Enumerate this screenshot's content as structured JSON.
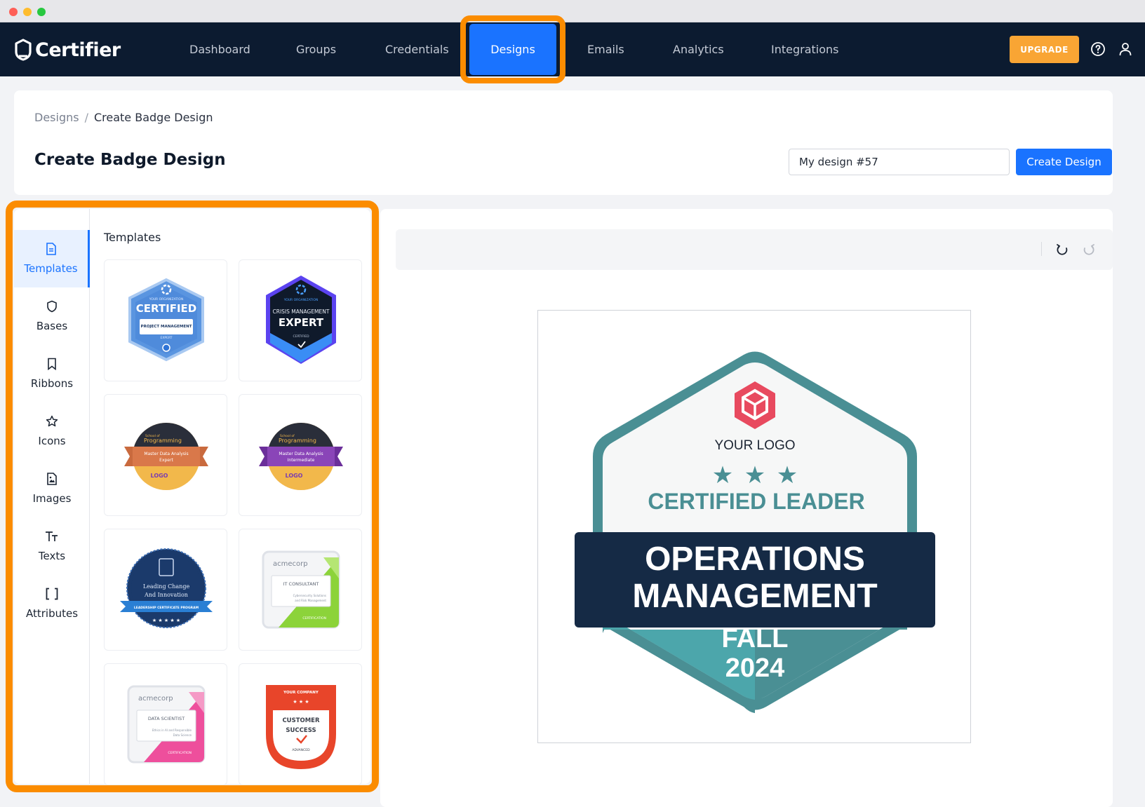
{
  "window": {
    "controls": [
      "close",
      "minimize",
      "maximize"
    ]
  },
  "nav": {
    "brand": "Certifier",
    "items": [
      "Dashboard",
      "Groups",
      "Credentials",
      "Designs",
      "Emails",
      "Analytics",
      "Integrations"
    ],
    "active": "Designs",
    "upgrade_label": "UPGRADE",
    "icons": [
      "help-circle-icon",
      "user-icon"
    ]
  },
  "colors": {
    "navy": "#0c1b30",
    "accent_blue": "#1a73ff",
    "highlight_orange": "#fb8c00",
    "upgrade_orange": "#f9a534",
    "teal": "#4a8f94"
  },
  "breadcrumb": {
    "parent": "Designs",
    "separator": "/",
    "current": "Create Badge Design"
  },
  "page": {
    "title": "Create Badge Design",
    "design_name": "My design #57",
    "create_label": "Create Design"
  },
  "sidebar": {
    "tabs": [
      {
        "label": "Templates",
        "icon": "file-icon"
      },
      {
        "label": "Bases",
        "icon": "shield-icon"
      },
      {
        "label": "Ribbons",
        "icon": "bookmark-icon"
      },
      {
        "label": "Icons",
        "icon": "star-icon"
      },
      {
        "label": "Images",
        "icon": "image-icon"
      },
      {
        "label": "Texts",
        "icon": "text-icon"
      },
      {
        "label": "Attributes",
        "icon": "brackets-icon"
      }
    ],
    "active": "Templates"
  },
  "templates": {
    "heading": "Templates",
    "t1": {
      "l1": "YOUR ORGANIZATION",
      "l2": "CERTIFIED",
      "l3": "PROJECT MANAGEMENT",
      "l4": "EXPERT"
    },
    "t2": {
      "l1": "YOUR ORGANIZATION",
      "l2": "CRISIS MANAGEMENT",
      "l3": "EXPERT",
      "l4": "CERTIFIED"
    },
    "t3": {
      "l1": "School of",
      "l2": "Programming",
      "l3": "Master Data Analysis",
      "l4": "Expert",
      "logo": "LOGO"
    },
    "t4": {
      "l1": "School of",
      "l2": "Programming",
      "l3": "Master Data Analysis",
      "l4": "Intermediate",
      "logo": "LOGO"
    },
    "t5": {
      "l1": "Leading Change",
      "l2": "And Innovation",
      "l3": "LEADERSHIP CERTIFICATE PROGRAM"
    },
    "t6": {
      "brand": "acmecorp",
      "l1": "IT CONSULTANT",
      "l2": "Cybersecurity Solutions",
      "l3": "and Risk Management",
      "l4": "CERTIFICATION"
    },
    "t7": {
      "brand": "acmecorp",
      "l1": "DATA SCIENTIST",
      "l2": "Ethics in AI and Responsible",
      "l3": "Data Science",
      "l4": "CERTIFICATION"
    },
    "t8": {
      "l1": "YOUR COMPANY",
      "l2": "CUSTOMER",
      "l3": "SUCCESS",
      "l4": "ADVANCED"
    }
  },
  "toolbar": {
    "icons": [
      "undo-icon",
      "redo-icon"
    ]
  },
  "badge": {
    "logo_text": "YOUR LOGO",
    "subtitle": "CERTIFIED LEADER",
    "title_line1": "OPERATIONS",
    "title_line2": "MANAGEMENT",
    "season": "FALL",
    "year": "2024",
    "stars": 3
  }
}
